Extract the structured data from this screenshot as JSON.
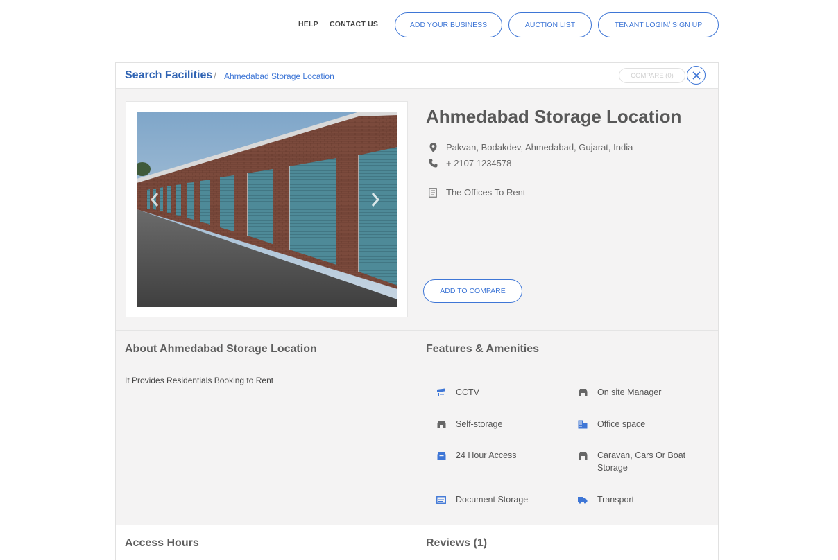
{
  "nav": {
    "help": "HELP",
    "contact": "CONTACT US",
    "add_business": "ADD YOUR BUSINESS",
    "auction_list": "AUCTION LIST",
    "tenant_login": "TENANT LOGIN/ SIGN UP"
  },
  "breadcrumb": {
    "root": "Search Facilities",
    "separator": "/",
    "current": "Ahmedabad Storage Location"
  },
  "compare_chip": "COMPARE (0)",
  "listing": {
    "title": "Ahmedabad Storage Location",
    "address": "Pakvan, Bodakdev, Ahmedabad, Gujarat, India",
    "phone": "+ 2107 1234578",
    "category": "The Offices To Rent",
    "add_to_compare": "ADD TO COMPARE"
  },
  "about": {
    "heading": "About Ahmedabad Storage Location",
    "text": "It Provides Residentials Booking to Rent"
  },
  "features": {
    "heading": "Features & Amenities",
    "items": [
      {
        "label": "CCTV",
        "icon": "cctv-icon"
      },
      {
        "label": "On site Manager",
        "icon": "manager-icon"
      },
      {
        "label": "Self-storage",
        "icon": "storage-icon"
      },
      {
        "label": "Office space",
        "icon": "building-icon"
      },
      {
        "label": "24 Hour Access",
        "icon": "access-icon"
      },
      {
        "label": "Caravan, Cars Or Boat Storage",
        "icon": "caravan-icon"
      },
      {
        "label": "Document Storage",
        "icon": "document-icon"
      },
      {
        "label": "Transport",
        "icon": "truck-icon"
      }
    ]
  },
  "access_hours": {
    "heading": "Access Hours"
  },
  "reviews": {
    "heading": "Reviews (1)"
  },
  "colors": {
    "accent": "#3e76d6",
    "breadcrumb": "#2f63b3",
    "card_bg": "#f4f3f3",
    "door": "#4e8a98",
    "brick": "#7b4a3c"
  }
}
